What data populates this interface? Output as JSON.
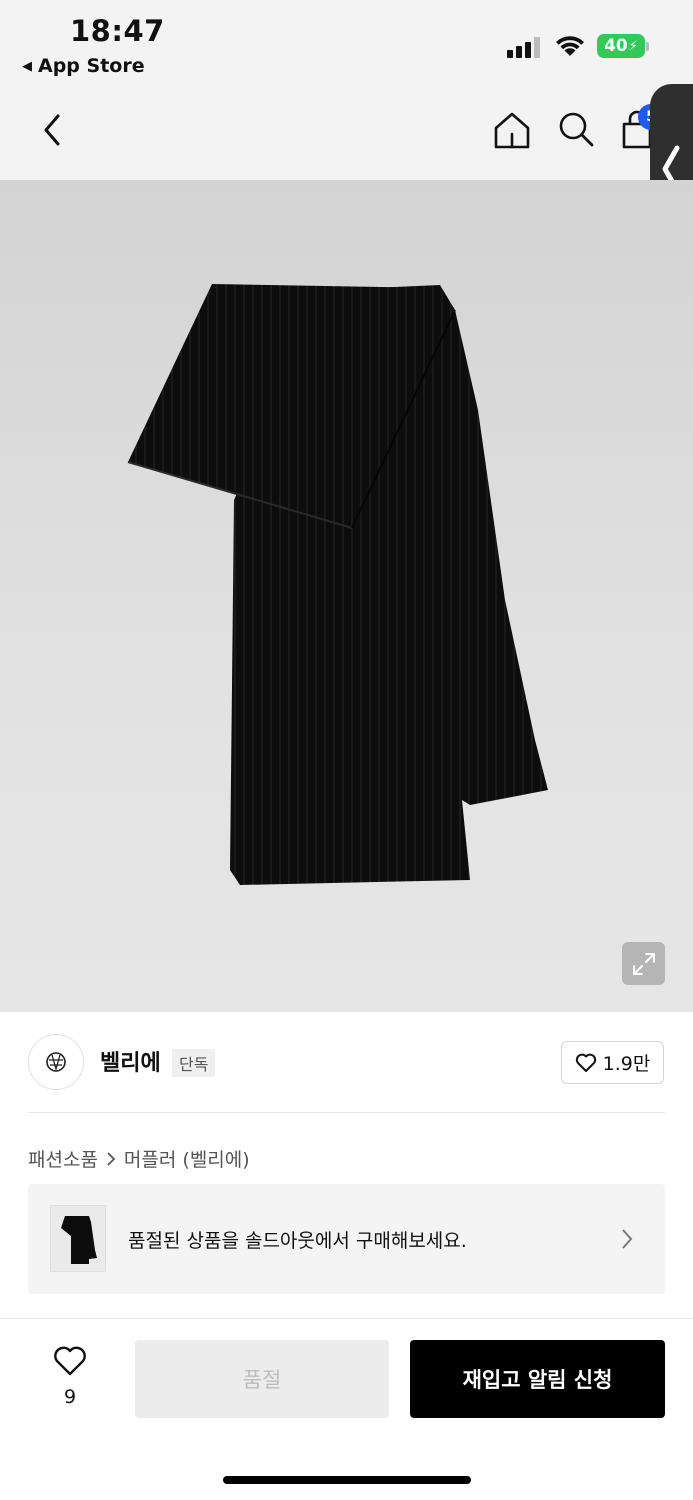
{
  "status_bar": {
    "time": "18:47",
    "back_app": "App Store",
    "battery": "40"
  },
  "nav": {
    "cart_count": "5"
  },
  "brand": {
    "name": "벨리에",
    "tag": "단독",
    "likes": "1.9만"
  },
  "breadcrumb": {
    "category": "패션소품",
    "subcategory": "머플러 (벨리에)"
  },
  "soldout_banner": {
    "text": "품절된 상품을 솔드아웃에서 구매해보세요."
  },
  "bottom_bar": {
    "wish_count": "9",
    "soldout_label": "품절",
    "restock_label": "재입고 알림 신청"
  },
  "colors": {
    "accent_blue": "#1f5bf0",
    "battery_green": "#34c759",
    "primary_button": "#000000"
  },
  "icons": [
    "chevron-left-icon",
    "home-icon",
    "search-icon",
    "shopping-bag-icon",
    "expand-icon",
    "heart-icon",
    "chevron-right-icon",
    "brand-logo-icon"
  ]
}
